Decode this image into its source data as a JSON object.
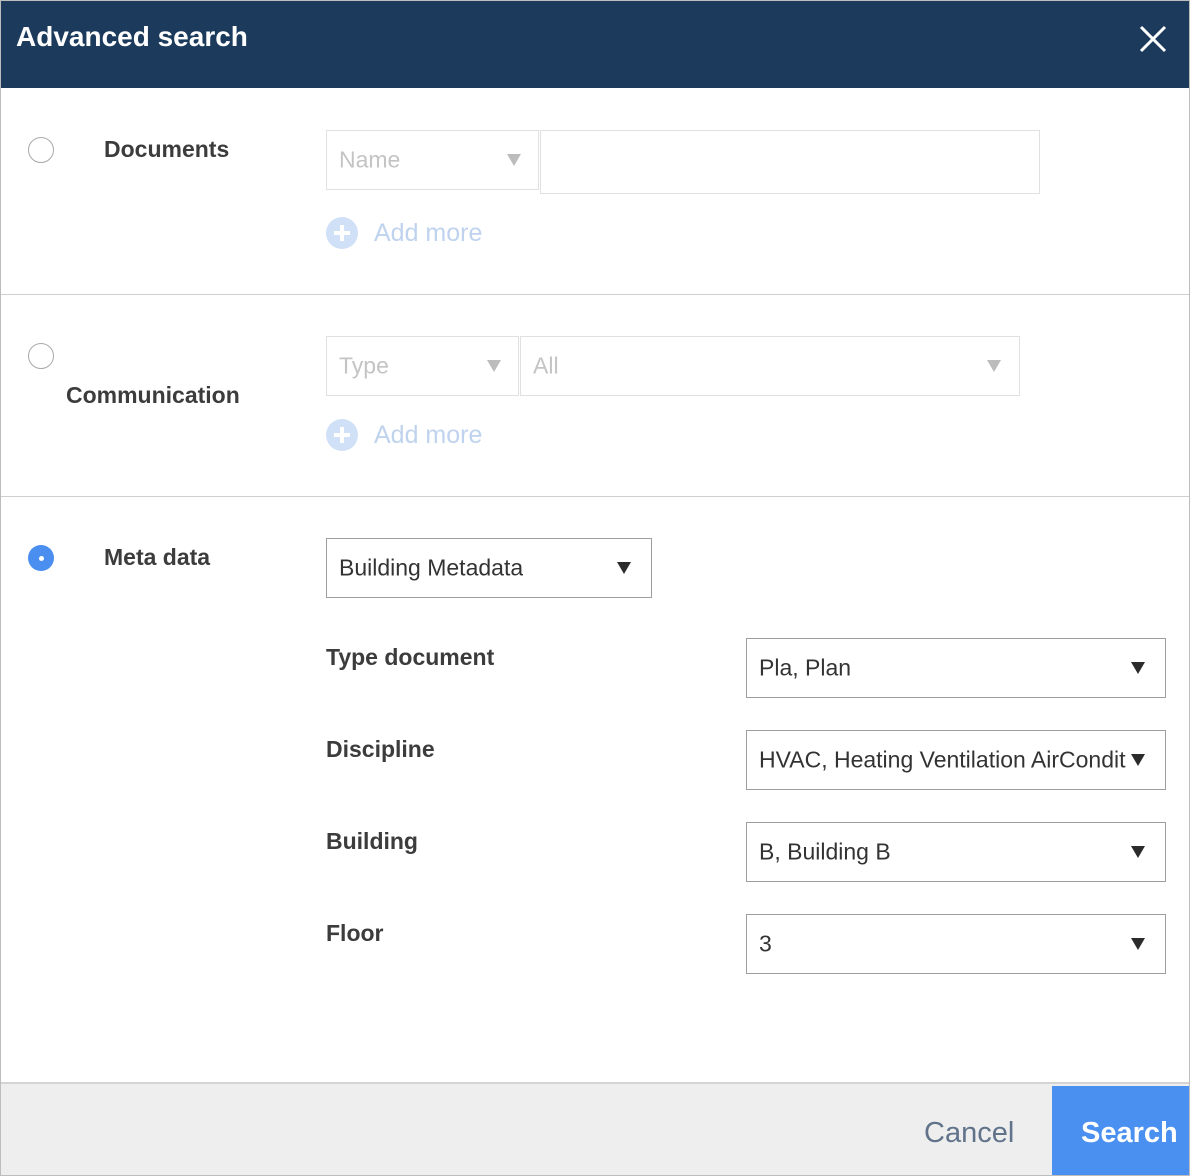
{
  "dialog": {
    "title": "Advanced search",
    "close_icon": "close-icon"
  },
  "documents": {
    "label": "Documents",
    "selected": false,
    "field_select": "Name",
    "text_value": "",
    "add_more": "Add more"
  },
  "communication": {
    "label": "Communication",
    "selected": false,
    "type_select": "Type",
    "value_select": "All",
    "add_more": "Add more"
  },
  "metadata": {
    "label": "Meta data",
    "selected": true,
    "template_select": "Building Metadata",
    "fields": [
      {
        "label": "Type document",
        "value": "Pla, Plan"
      },
      {
        "label": "Discipline",
        "value": "HVAC, Heating Ventilation AirCondit"
      },
      {
        "label": "Building",
        "value": "B, Building B"
      },
      {
        "label": "Floor",
        "value": "3"
      }
    ]
  },
  "footer": {
    "cancel_label": "Cancel",
    "search_label": "Search"
  },
  "colors": {
    "header_bg": "#1b3a5c",
    "accent": "#4a90f0",
    "radio_checked": "#4a8ef0"
  }
}
